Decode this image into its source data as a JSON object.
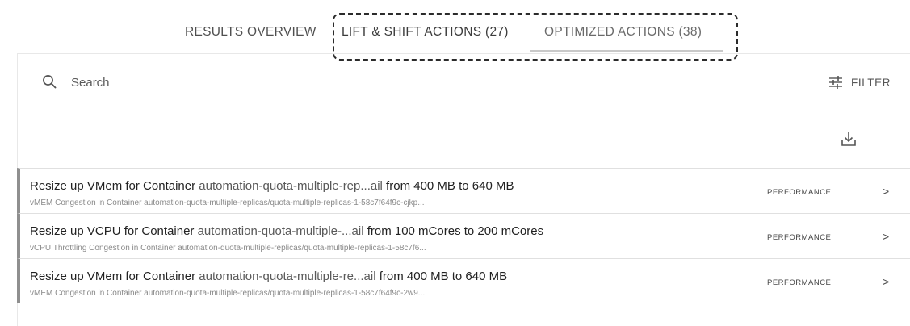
{
  "tabs": {
    "results": "RESULTS OVERVIEW",
    "lift_shift": "LIFT & SHIFT ACTIONS (27)",
    "optimized": "OPTIMIZED ACTIONS (38)"
  },
  "search": {
    "placeholder": "Search",
    "icon": "search-icon"
  },
  "filter": {
    "label": "FILTER",
    "icon": "sliders-icon"
  },
  "download": {
    "icon": "download-icon"
  },
  "actions": [
    {
      "title_pre": "Resize up VMem for Container ",
      "title_entity": "automation-quota-multiple-rep...ail",
      "title_post": " from 400 MB to 640 MB",
      "subtitle": "vMEM Congestion in Container automation-quota-multiple-replicas/quota-multiple-replicas-1-58c7f64f9c-cjkp...",
      "category": "PERFORMANCE"
    },
    {
      "title_pre": "Resize up VCPU for Container ",
      "title_entity": "automation-quota-multiple-...ail",
      "title_post": " from 100 mCores to 200 mCores",
      "subtitle": "vCPU Throttling Congestion in Container automation-quota-multiple-replicas/quota-multiple-replicas-1-58c7f6...",
      "category": "PERFORMANCE"
    },
    {
      "title_pre": "Resize up VMem for Container ",
      "title_entity": "automation-quota-multiple-re...ail",
      "title_post": " from 400 MB to 640 MB",
      "subtitle": "vMEM Congestion in Container automation-quota-multiple-replicas/quota-multiple-replicas-1-58c7f64f9c-2w9...",
      "category": "PERFORMANCE"
    }
  ],
  "chevron": ">"
}
